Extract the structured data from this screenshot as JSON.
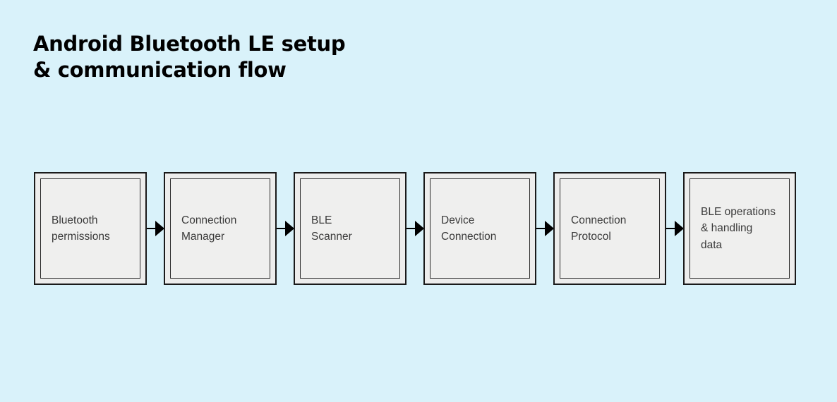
{
  "title": {
    "line1": "Android Bluetooth LE setup",
    "line2": "& communication flow"
  },
  "colors": {
    "background": "#d9f2fa",
    "node_fill": "#efefee",
    "node_border": "#1a1a1a",
    "text": "#3a3a3a",
    "title_text": "#000000",
    "arrow": "#000000"
  },
  "diagram": {
    "type": "linear-flow",
    "direction": "left-to-right",
    "node_count": 6,
    "nodes": [
      {
        "id": "bluetooth-permissions",
        "label": "Bluetooth\npermissions"
      },
      {
        "id": "connection-manager",
        "label": "Connection\nManager"
      },
      {
        "id": "ble-scanner",
        "label": "BLE\nScanner"
      },
      {
        "id": "device-connection",
        "label": "Device\nConnection"
      },
      {
        "id": "connection-protocol",
        "label": "Connection\nProtocol"
      },
      {
        "id": "ble-operations",
        "label": "BLE operations\n& handling\ndata"
      }
    ],
    "connectors": [
      {
        "from": "bluetooth-permissions",
        "to": "connection-manager",
        "glyph": "arrow-right-icon"
      },
      {
        "from": "connection-manager",
        "to": "ble-scanner",
        "glyph": "arrow-right-icon"
      },
      {
        "from": "ble-scanner",
        "to": "device-connection",
        "glyph": "arrow-right-icon"
      },
      {
        "from": "device-connection",
        "to": "connection-protocol",
        "glyph": "arrow-right-icon"
      },
      {
        "from": "connection-protocol",
        "to": "ble-operations",
        "glyph": "arrow-right-icon"
      }
    ]
  }
}
